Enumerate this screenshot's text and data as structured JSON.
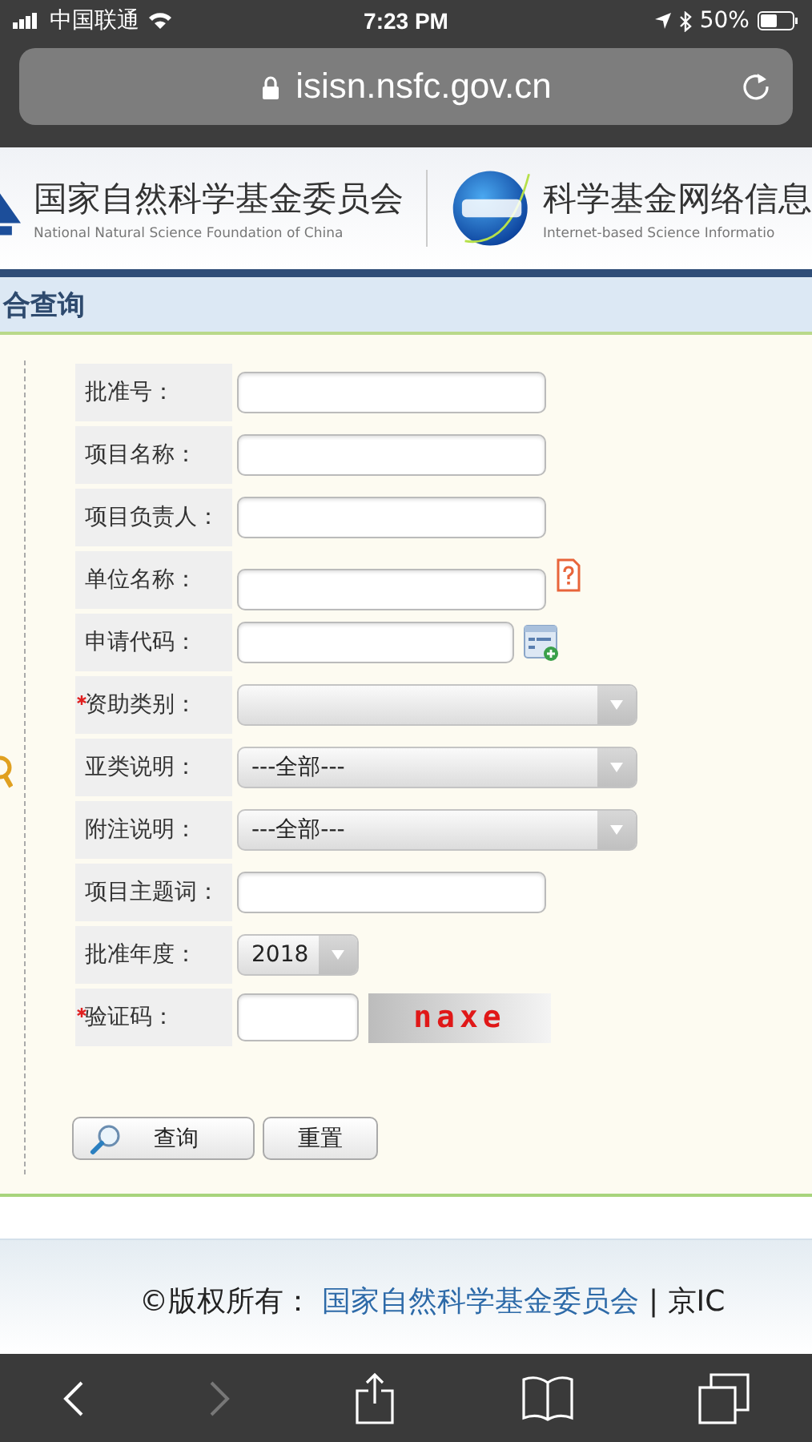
{
  "status_bar": {
    "carrier": "中国联通",
    "time": "7:23 PM",
    "battery": "50%"
  },
  "address_bar": {
    "url": "isisn.nsfc.gov.cn"
  },
  "header": {
    "org_name": "国家自然科学基金委员会",
    "org_name_en": "National Natural Science Foundation of China",
    "system_name": "科学基金网络信息",
    "system_name_en": "Internet-based Science Informatio"
  },
  "page_title": "合查询",
  "form": {
    "fields": [
      {
        "label": "批准号：",
        "kind": "text",
        "required": false
      },
      {
        "label": "项目名称：",
        "kind": "text",
        "required": false
      },
      {
        "label": "项目负责人：",
        "kind": "text",
        "required": false
      },
      {
        "label": "单位名称：",
        "kind": "helptext",
        "required": false
      },
      {
        "label": "申请代码：",
        "kind": "pickertext",
        "required": false
      },
      {
        "label": "资助类别：",
        "kind": "select",
        "required": true
      },
      {
        "label": "亚类说明：",
        "kind": "select",
        "required": false,
        "value": "---全部---"
      },
      {
        "label": "附注说明：",
        "kind": "select",
        "required": false,
        "value": "---全部---"
      },
      {
        "label": "项目主题词：",
        "kind": "text",
        "required": false
      },
      {
        "label": "批准年度：",
        "kind": "year",
        "required": false,
        "value": "2018"
      },
      {
        "label": "验证码：",
        "kind": "captcha",
        "required": true,
        "captcha": "naxe"
      }
    ],
    "buttons": [
      {
        "label": "查询",
        "kind": "search"
      },
      {
        "label": "重置",
        "kind": "reset"
      }
    ]
  },
  "footer": {
    "prefix": "©版权所有：",
    "link": "国家自然科学基金委员会",
    "suffix": "| 京IC"
  }
}
